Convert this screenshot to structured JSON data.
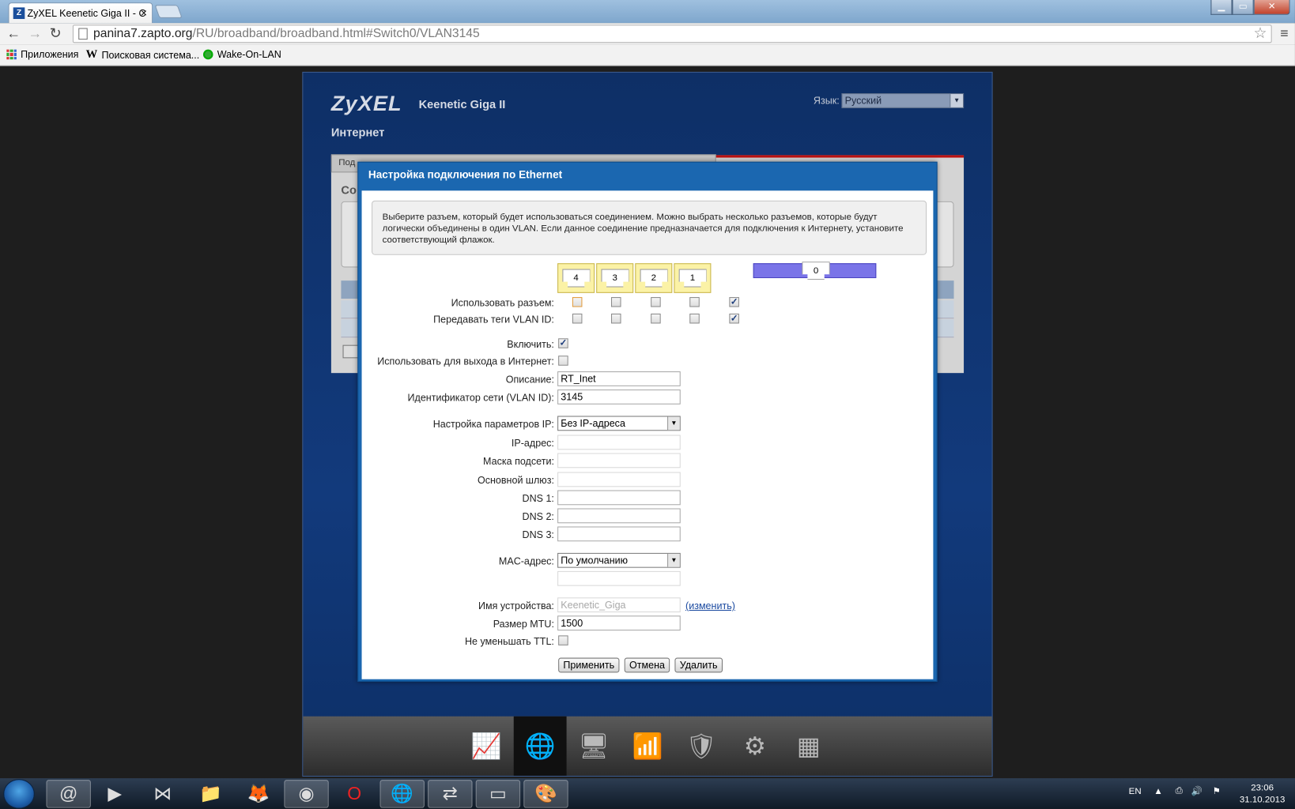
{
  "browser": {
    "tab_title": "ZyXEL Keenetic Giga II - С",
    "tab_favicon": "Z",
    "url_host": "panina7.zapto.org",
    "url_path": "/RU/broadband/broadband.html#Switch0/VLAN3145",
    "bookmarks": [
      "Приложения",
      "Поисковая система...",
      "Wake-On-LAN"
    ]
  },
  "router": {
    "logo": "ZyXEL",
    "model": "Keenetic Giga II",
    "lang_label": "Язык:",
    "lang_value": "Русский",
    "page_title": "Интернет",
    "bg_tab": "Под",
    "bg_section": "Со",
    "dock_icons": [
      "monitor-icon",
      "globe-icon",
      "computers-icon",
      "signal-icon",
      "shield-icon",
      "gear-icon",
      "apps-icon"
    ]
  },
  "dialog": {
    "title": "Настройка подключения по Ethernet",
    "note": "Выберите разъем, который будет использоваться соединением. Можно выбрать несколько разъемов, которые будут логически объединены в один VLAN. Если данное соединение предназначается для подключения к Интернету, установите соответствующий флажок.",
    "ports": [
      "4",
      "3",
      "2",
      "1",
      "0"
    ],
    "use_port_label": "Использовать разъем:",
    "use_port_checked": [
      false,
      false,
      false,
      false,
      true
    ],
    "vlan_tag_label": "Передавать теги VLAN ID:",
    "vlan_tag_checked": [
      false,
      false,
      false,
      false,
      true
    ],
    "enable_label": "Включить:",
    "enable_checked": true,
    "internet_label": "Использовать для выхода в Интернет:",
    "internet_checked": false,
    "description_label": "Описание:",
    "description_value": "RT_Inet",
    "vlan_id_label": "Идентификатор сети (VLAN ID):",
    "vlan_id_value": "3145",
    "ip_settings_label": "Настройка параметров IP:",
    "ip_settings_value": "Без IP-адреса",
    "ip_label": "IP-адрес:",
    "mask_label": "Маска подсети:",
    "gateway_label": "Основной шлюз:",
    "dns1_label": "DNS 1:",
    "dns2_label": "DNS 2:",
    "dns3_label": "DNS 3:",
    "mac_label": "MAC-адрес:",
    "mac_value": "По умолчанию",
    "device_name_label": "Имя устройства:",
    "device_name_value": "Keenetic_Giga",
    "change_link": "(изменить)",
    "mtu_label": "Размер MTU:",
    "mtu_value": "1500",
    "ttl_label": "Не уменьшать TTL:",
    "ttl_checked": false,
    "apply_button": "Применить",
    "cancel_button": "Отмена",
    "delete_button": "Удалить"
  },
  "taskbar": {
    "lang": "EN",
    "time": "23:06",
    "date": "31.10.2013"
  }
}
